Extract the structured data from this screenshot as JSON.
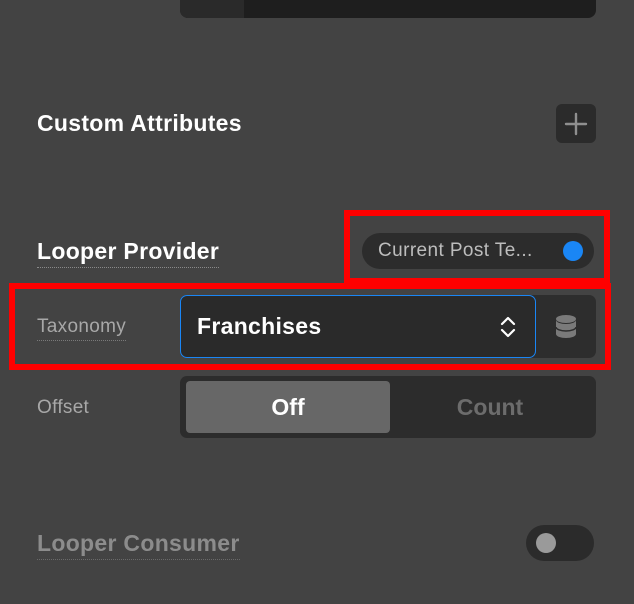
{
  "custom_attributes": {
    "label": "Custom Attributes",
    "add_icon": "plus-icon"
  },
  "looper_provider": {
    "label": "Looper Provider",
    "value": "Current Post Te...",
    "enabled": true,
    "indicator_color": "#1a86f5"
  },
  "taxonomy": {
    "label": "Taxonomy",
    "value": "Franchises",
    "select_icon": "chevron-updown-icon",
    "dynamic_icon": "database-icon",
    "focus_color": "#1a86f5"
  },
  "offset": {
    "label": "Offset",
    "options": [
      "Off",
      "Count"
    ],
    "selected": "Off"
  },
  "looper_consumer": {
    "label": "Looper Consumer",
    "enabled": false
  },
  "highlight_color": "#ff0000"
}
